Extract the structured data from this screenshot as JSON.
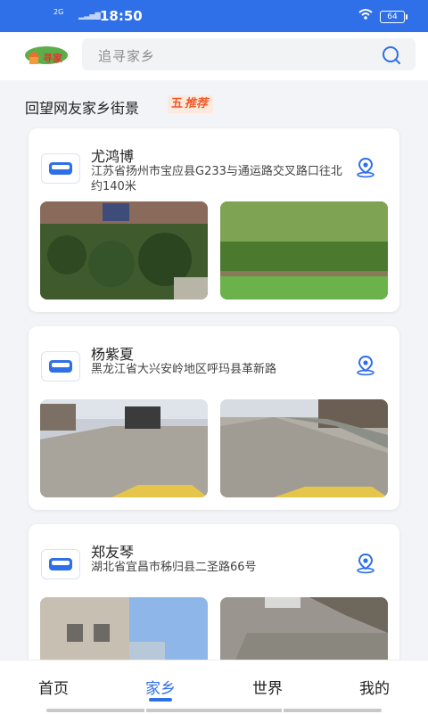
{
  "status_bar": {
    "network": "2G",
    "time": "18:50",
    "battery": "64"
  },
  "header": {
    "logo_text": "寻家乡",
    "search_placeholder": "追寻家乡"
  },
  "section": {
    "title": "回望网友家乡街景",
    "badge": "推荐",
    "badge_prefix": "五"
  },
  "cards": [
    {
      "name": "尤鸿博",
      "address": "江苏省扬州市宝应县G233与通运路交叉路口往北约140米"
    },
    {
      "name": "杨紫夏",
      "address": "黑龙江省大兴安岭地区呼玛县革新路"
    },
    {
      "name": "郑友琴",
      "address": "湖北省宜昌市秭归县二圣路66号"
    }
  ],
  "nav": {
    "items": [
      {
        "label": "首页"
      },
      {
        "label": "家乡"
      },
      {
        "label": "世界"
      },
      {
        "label": "我的"
      }
    ],
    "active": "家乡"
  },
  "colors": {
    "accent": "#2f6fe8",
    "badge_text": "#ef5a2a",
    "badge_bg": "#fde9dd"
  }
}
